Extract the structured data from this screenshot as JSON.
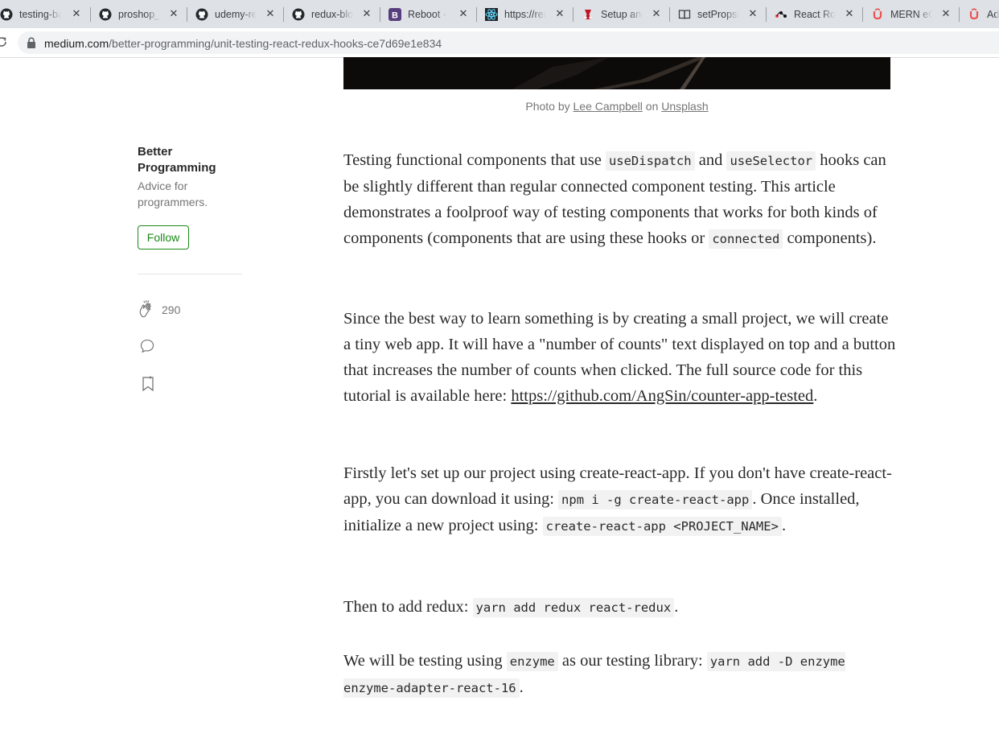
{
  "tabs": [
    {
      "title": "testing-ba",
      "icon": "github-icon"
    },
    {
      "title": "proshop_r",
      "icon": "github-icon"
    },
    {
      "title": "udemy-re",
      "icon": "github-icon"
    },
    {
      "title": "redux-blo",
      "icon": "github-icon"
    },
    {
      "title": "Reboot · B",
      "icon": "bootstrap-icon"
    },
    {
      "title": "https://rea",
      "icon": "react-icon"
    },
    {
      "title": "Setup and",
      "icon": "jest-icon"
    },
    {
      "title": "setProps(",
      "icon": "book-icon"
    },
    {
      "title": "React Rou",
      "icon": "react-router-icon"
    },
    {
      "title": "MERN eCo",
      "icon": "udemy-icon"
    },
    {
      "title": "Ad",
      "icon": "udemy-icon"
    }
  ],
  "address": {
    "host": "medium.com",
    "path": "/better-programming/unit-testing-react-redux-hooks-ce7d69e1e834"
  },
  "caption": {
    "prefix": "Photo by ",
    "author": "Lee Campbell",
    "middle": " on ",
    "source": "Unsplash"
  },
  "sidebar": {
    "publication": "Better Programming",
    "description": "Advice for programmers.",
    "follow_label": "Follow",
    "claps": "290"
  },
  "article": {
    "p1": {
      "a": "Testing functional components that use ",
      "code1": "useDispatch",
      "b": " and ",
      "code2": "useSelector",
      "c": " hooks can be slightly different than regular connected component testing. This article demonstrates a foolproof way of testing components that works for both kinds of components (components that are using these hooks or ",
      "code3": "connected",
      "d": " components)."
    },
    "p2": {
      "a": "Since the best way to learn something is by creating a small project, we will create a tiny web app. It will have a \"number of counts\" text displayed on top and a button that increases the number of counts when clicked. The full source code for this tutorial is available here: ",
      "link": "https://github.com/AngSin/counter-app-tested",
      "b": "."
    },
    "p3": {
      "a": "Firstly let's set up our project using create-react-app. If you don't have create-react-app, you can download it using: ",
      "code1": "npm i -g create-react-app",
      "b": ". Once installed, initialize a new project using: ",
      "code2": "create-react-app <PROJECT_NAME>",
      "c": "."
    },
    "p4": {
      "a": "Then to add redux: ",
      "code1": "yarn add redux react-redux",
      "b": "."
    },
    "p5": {
      "a": "We will be testing using ",
      "code1": "enzyme",
      "b": " as our testing library: ",
      "code2": "yarn add -D enzyme enzyme-adapter-react-16",
      "c": "."
    }
  },
  "colors": {
    "follow_green": "#1a8917",
    "text": "#292929",
    "muted": "#757575",
    "code_bg": "#f2f2f2"
  }
}
